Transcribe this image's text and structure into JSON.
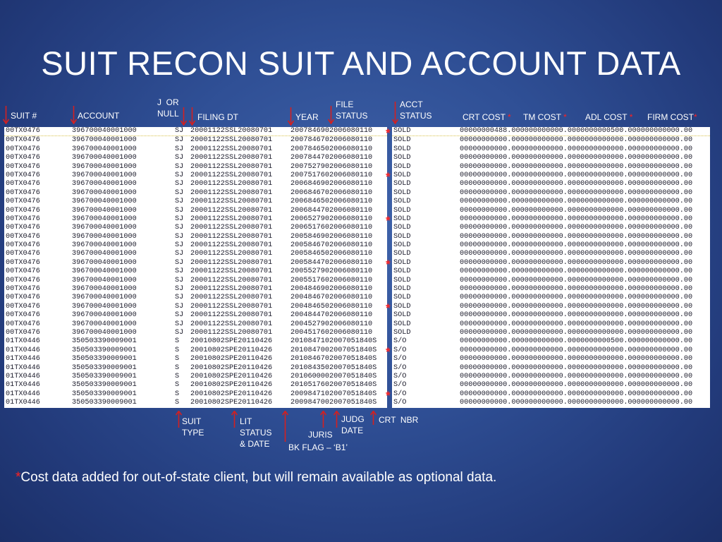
{
  "title": "SUIT RECON SUIT AND ACCOUNT DATA",
  "top_labels": {
    "suit_num": "SUIT #",
    "account": "ACCOUNT",
    "j_or_null": "J  OR\nNULL",
    "filing_dt": "FILING DT",
    "year": "YEAR",
    "file_status": "FILE\nSTATUS",
    "acct_status": "ACCT\nSTATUS",
    "crt_cost": "CRT COST",
    "tm_cost": "TM COST",
    "adl_cost": "ADL COST",
    "firm_cost": "FIRM COST",
    "star": "*"
  },
  "bottom_labels": {
    "suit_type": "SUIT\nTYPE",
    "lit_status": "LIT\nSTATUS\n& DATE",
    "bk_flag": "BK FLAG – ‘B1’",
    "juris": "JURIS",
    "judg_date": "JUDG\nDATE",
    "crt_nbr": "CRT  NBR"
  },
  "left_rows": [
    [
      "00TX0476",
      "396700040001000",
      "SJ",
      "20001122SSL20080701",
      "2007846902006080110"
    ],
    [
      "00TX0476",
      "396700040001000",
      "SJ",
      "20001122SSL20080701",
      "2007846702006080110"
    ],
    [
      "00TX0476",
      "396700040001000",
      "SJ",
      "20001122SSL20080701",
      "2007846502006080110"
    ],
    [
      "00TX0476",
      "396700040001000",
      "SJ",
      "20001122SSL20080701",
      "2007844702006080110"
    ],
    [
      "00TX0476",
      "396700040001000",
      "SJ",
      "20001122SSL20080701",
      "2007527902006080110"
    ],
    [
      "00TX0476",
      "396700040001000",
      "SJ",
      "20001122SSL20080701",
      "2007517602006080110"
    ],
    [
      "00TX0476",
      "396700040001000",
      "SJ",
      "20001122SSL20080701",
      "2006846902006080110"
    ],
    [
      "00TX0476",
      "396700040001000",
      "SJ",
      "20001122SSL20080701",
      "2006846702006080110"
    ],
    [
      "00TX0476",
      "396700040001000",
      "SJ",
      "20001122SSL20080701",
      "2006846502006080110"
    ],
    [
      "00TX0476",
      "396700040001000",
      "SJ",
      "20001122SSL20080701",
      "2006844702006080110"
    ],
    [
      "00TX0476",
      "396700040001000",
      "SJ",
      "20001122SSL20080701",
      "2006527902006080110"
    ],
    [
      "00TX0476",
      "396700040001000",
      "SJ",
      "20001122SSL20080701",
      "2006517602006080110"
    ],
    [
      "00TX0476",
      "396700040001000",
      "SJ",
      "20001122SSL20080701",
      "2005846902006080110"
    ],
    [
      "00TX0476",
      "396700040001000",
      "SJ",
      "20001122SSL20080701",
      "2005846702006080110"
    ],
    [
      "00TX0476",
      "396700040001000",
      "SJ",
      "20001122SSL20080701",
      "2005846502006080110"
    ],
    [
      "00TX0476",
      "396700040001000",
      "SJ",
      "20001122SSL20080701",
      "2005844702006080110"
    ],
    [
      "00TX0476",
      "396700040001000",
      "SJ",
      "20001122SSL20080701",
      "2005527902006080110"
    ],
    [
      "00TX0476",
      "396700040001000",
      "SJ",
      "20001122SSL20080701",
      "2005517602006080110"
    ],
    [
      "00TX0476",
      "396700040001000",
      "SJ",
      "20001122SSL20080701",
      "2004846902006080110"
    ],
    [
      "00TX0476",
      "396700040001000",
      "SJ",
      "20001122SSL20080701",
      "2004846702006080110"
    ],
    [
      "00TX0476",
      "396700040001000",
      "SJ",
      "20001122SSL20080701",
      "2004846502006080110"
    ],
    [
      "00TX0476",
      "396700040001000",
      "SJ",
      "20001122SSL20080701",
      "2004844702006080110"
    ],
    [
      "00TX0476",
      "396700040001000",
      "SJ",
      "20001122SSL20080701",
      "2004527902006080110"
    ],
    [
      "00TX0476",
      "396700040001000",
      "SJ",
      "20001122SSL20080701",
      "2004517602006080110"
    ],
    [
      "01TX0446",
      "350503390009001",
      "S",
      "20010802SPE20110426",
      "2010847102007051840S"
    ],
    [
      "01TX0446",
      "350503390009001",
      "S",
      "20010802SPE20110426",
      "2010847002007051840S"
    ],
    [
      "01TX0446",
      "350503390009001",
      "S",
      "20010802SPE20110426",
      "2010846702007051840S"
    ],
    [
      "01TX0446",
      "350503390009001",
      "S",
      "20010802SPE20110426",
      "2010843502007051840S"
    ],
    [
      "01TX0446",
      "350503390009001",
      "S",
      "20010802SPE20110426",
      "2010600002007051840S"
    ],
    [
      "01TX0446",
      "350503390009001",
      "S",
      "20010802SPE20110426",
      "2010517602007051840S"
    ],
    [
      "01TX0446",
      "350503390009001",
      "S",
      "20010802SPE20110426",
      "2009847102007051840S"
    ],
    [
      "01TX0446",
      "350503390009001",
      "S",
      "20010802SPE20110426",
      "2009847002007051840S"
    ]
  ],
  "right_rows": [
    [
      "SOLD",
      "00000000488.000000000000.0000000000500.000000000000.00"
    ],
    [
      "SOLD",
      "00000000000.000000000000.0000000000000.000000000000.00"
    ],
    [
      "SOLD",
      "00000000000.000000000000.0000000000000.000000000000.00"
    ],
    [
      "SOLD",
      "00000000000.000000000000.0000000000000.000000000000.00"
    ],
    [
      "SOLD",
      "00000000000.000000000000.0000000000000.000000000000.00"
    ],
    [
      "SOLD",
      "00000000000.000000000000.0000000000000.000000000000.00"
    ],
    [
      "SOLD",
      "00000000000.000000000000.0000000000000.000000000000.00"
    ],
    [
      "SOLD",
      "00000000000.000000000000.0000000000000.000000000000.00"
    ],
    [
      "SOLD",
      "00000000000.000000000000.0000000000000.000000000000.00"
    ],
    [
      "SOLD",
      "00000000000.000000000000.0000000000000.000000000000.00"
    ],
    [
      "SOLD",
      "00000000000.000000000000.0000000000000.000000000000.00"
    ],
    [
      "SOLD",
      "00000000000.000000000000.0000000000000.000000000000.00"
    ],
    [
      "SOLD",
      "00000000000.000000000000.0000000000000.000000000000.00"
    ],
    [
      "SOLD",
      "00000000000.000000000000.0000000000000.000000000000.00"
    ],
    [
      "SOLD",
      "00000000000.000000000000.0000000000000.000000000000.00"
    ],
    [
      "SOLD",
      "00000000000.000000000000.0000000000000.000000000000.00"
    ],
    [
      "SOLD",
      "00000000000.000000000000.0000000000000.000000000000.00"
    ],
    [
      "SOLD",
      "00000000000.000000000000.0000000000000.000000000000.00"
    ],
    [
      "SOLD",
      "00000000000.000000000000.0000000000000.000000000000.00"
    ],
    [
      "SOLD",
      "00000000000.000000000000.0000000000000.000000000000.00"
    ],
    [
      "SOLD",
      "00000000000.000000000000.0000000000000.000000000000.00"
    ],
    [
      "SOLD",
      "00000000000.000000000000.0000000000000.000000000000.00"
    ],
    [
      "SOLD",
      "00000000000.000000000000.0000000000000.000000000000.00"
    ],
    [
      "SOLD",
      "00000000000.000000000000.0000000000000.000000000000.00"
    ],
    [
      "S/O",
      "00000000000.000000000000.0000000000500.000000000000.00"
    ],
    [
      "S/O",
      "00000000000.000000000000.0000000000000.000000000000.00"
    ],
    [
      "S/O",
      "00000000000.000000000000.0000000000000.000000000000.00"
    ],
    [
      "S/O",
      "00000000000.000000000000.0000000000000.000000000000.00"
    ],
    [
      "S/O",
      "00000000000.000000000000.0000000000000.000000000000.00"
    ],
    [
      "S/O",
      "00000000000.000000000000.0000000000000.000000000000.00"
    ],
    [
      "S/O",
      "00000000000.000000000000.0000000000000.000000000000.00"
    ],
    [
      "S/O",
      "00000000000.000000000000.0000000000000.000000000000.00"
    ]
  ],
  "row_stars": [
    0,
    5,
    10,
    15,
    20,
    25,
    30
  ],
  "footnote": {
    "star": "*",
    "text": "Cost data added for out-of-state client, but will remain available as optional data."
  },
  "colors": {
    "accent_red": "#ff2424",
    "background": "#2f4f95"
  }
}
